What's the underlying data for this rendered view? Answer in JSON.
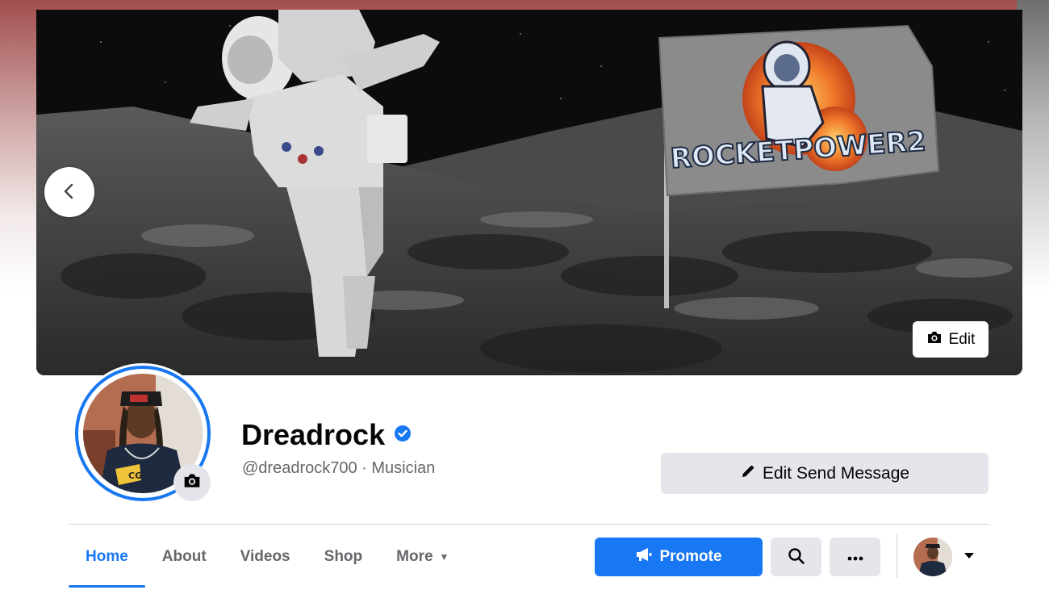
{
  "cover": {
    "flag_text": "ROCKETPOWER2",
    "edit_label": "Edit",
    "prev_icon": "chevron-left-icon",
    "camera_icon": "camera-icon"
  },
  "profile": {
    "name": "Dreadrock",
    "verified_icon": "verified-badge-icon",
    "subtitle": "@dreadrock700 · Musician",
    "edit_message_label": "Edit Send Message"
  },
  "tabs": [
    {
      "label": "Home",
      "active": true
    },
    {
      "label": "About",
      "active": false
    },
    {
      "label": "Videos",
      "active": false
    },
    {
      "label": "Shop",
      "active": false
    },
    {
      "label": "More",
      "active": false
    }
  ],
  "actions": {
    "promote_label": "Promote",
    "search_icon": "search-icon",
    "more_icon": "more-dots-icon",
    "switcher_icon": "caret-down-icon"
  },
  "colors": {
    "accent": "#1877f2",
    "button_gray": "#e4e6eb",
    "secondary_text": "#65676b"
  }
}
